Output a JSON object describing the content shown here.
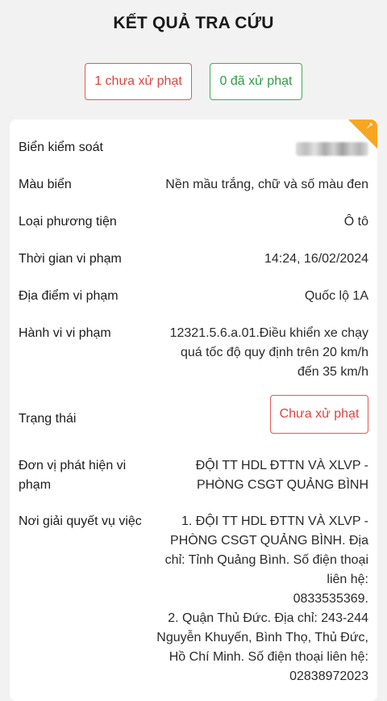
{
  "header": {
    "title": "KẾT QUẢ TRA CỨU"
  },
  "filters": {
    "unpaid_label": "1 chưa xử phạt",
    "paid_label": "0 đã xử phạt"
  },
  "card": {
    "corner_icon": "edit-icon",
    "plate": {
      "label": "Biển kiểm soát",
      "value": ""
    },
    "plate_color": {
      "label": "Màu biển",
      "value": "Nền mầu trắng, chữ và số màu đen"
    },
    "vehicle_type": {
      "label": "Loại phương tiện",
      "value": "Ô tô"
    },
    "time": {
      "label": "Thời gian vi phạm",
      "value": "14:24, 16/02/2024"
    },
    "location": {
      "label": "Địa điểm vi phạm",
      "value": "Quốc lộ 1A"
    },
    "violation": {
      "label": "Hành vi vi phạm",
      "lines": [
        "12321.5.6.a.01.Điều khiển xe chạy",
        "quá tốc độ quy định trên 20 km/h",
        "đến 35 km/h"
      ]
    },
    "status": {
      "label": "Trạng thái",
      "value": "Chưa xử phạt"
    },
    "detecting_unit": {
      "label_lines": [
        "Đơn vị phát hiện vi",
        "phạm"
      ],
      "lines": [
        "ĐỘI TT HDL ĐTTN VÀ XLVP -",
        "PHÒNG CSGT QUẢNG BÌNH"
      ]
    },
    "resolution_place": {
      "label": "Nơi giải quyết vụ việc",
      "lines": [
        "1. ĐỘI TT HDL ĐTTN VÀ XLVP -",
        "PHÒNG CSGT QUẢNG BÌNH. Địa",
        "chỉ: Tỉnh Quảng Bình. Số điện thoại",
        "liên hệ:",
        "0833535369.",
        "2. Quận Thủ Đức. Địa chỉ: 243-244",
        "Nguyễn Khuyến, Bình Thọ, Thủ Đức,",
        "Hồ Chí Minh. Số điện thoại liên hệ:",
        "02838972023"
      ]
    }
  }
}
